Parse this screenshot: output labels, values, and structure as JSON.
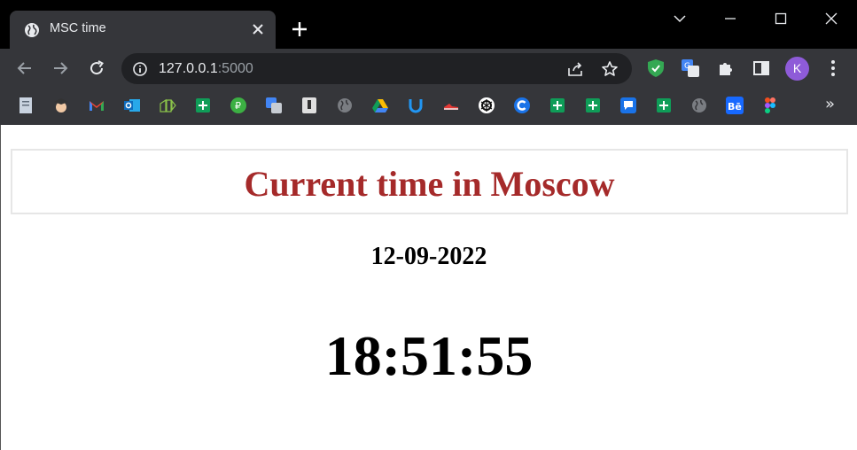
{
  "browser": {
    "tab": {
      "title": "MSC time"
    },
    "address_bar": {
      "host": "127.0.0.1",
      "port": ":5000"
    },
    "profile_initial": "K",
    "bookmarks_overflow": "»",
    "colors": {
      "avatar": "#8e5bd8",
      "toolbar": "#35363a",
      "tabstrip": "#000000"
    }
  },
  "page": {
    "heading": "Current time in Moscow",
    "date": "12-09-2022",
    "time": "18:51:55",
    "colors": {
      "heading": "#a52a2a"
    }
  }
}
